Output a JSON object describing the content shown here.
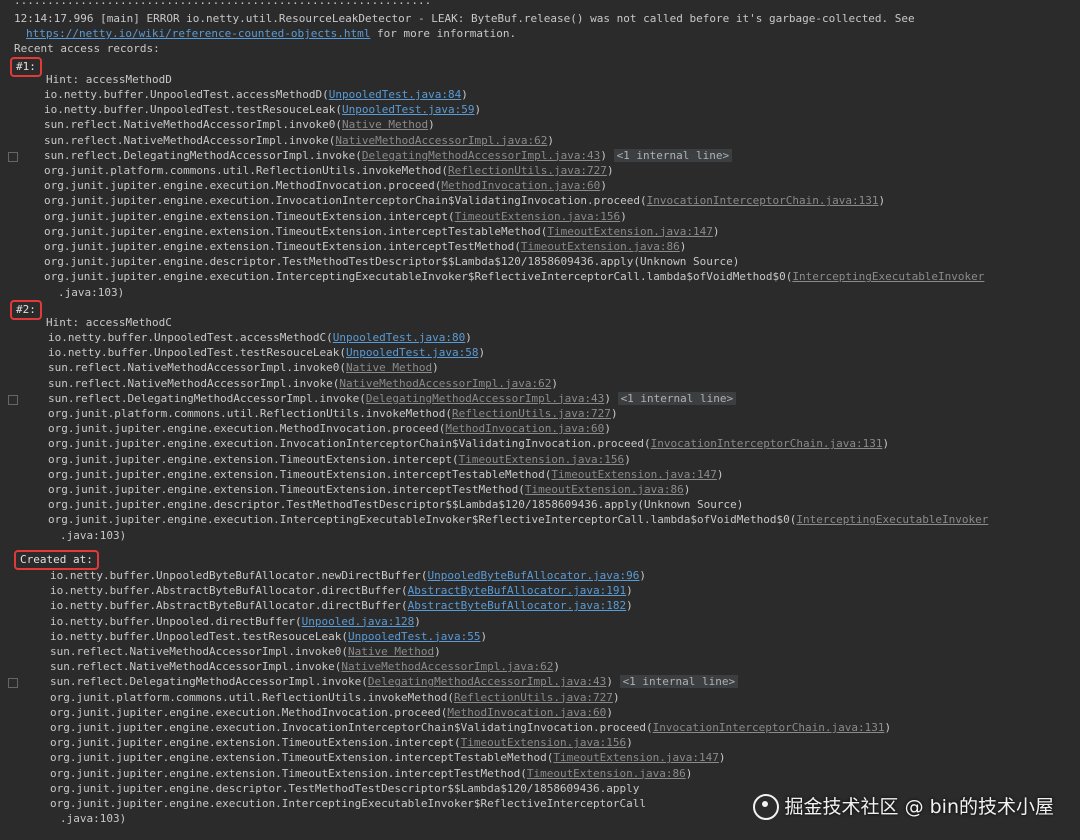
{
  "header": {
    "top_fragment": "...............................................................",
    "leak_line": "12:14:17.996 [main] ERROR io.netty.util.ResourceLeakDetector - LEAK: ByteBuf.release() was not called before it's garbage-collected. See",
    "wiki_link": "https://netty.io/wiki/reference-counted-objects.html",
    "wiki_suffix": " for more information.",
    "recent_access": "Recent access records:"
  },
  "records": [
    {
      "marker": "#1:",
      "hint": "Hint: accessMethodD",
      "frames": [
        {
          "text": "io.netty.buffer.UnpooledTest.accessMethodD(",
          "link": "UnpooledTest.java:84",
          "suffix": ")",
          "style": "link"
        },
        {
          "text": "io.netty.buffer.UnpooledTest.testResouceLeak(",
          "link": "UnpooledTest.java:59",
          "suffix": ")",
          "style": "link"
        },
        {
          "text": "sun.reflect.NativeMethodAccessorImpl.invoke0(",
          "link": "Native Method",
          "suffix": ")",
          "style": "dim"
        },
        {
          "text": "sun.reflect.NativeMethodAccessorImpl.invoke(",
          "link": "NativeMethodAccessorImpl.java:62",
          "suffix": ")",
          "style": "dim"
        },
        {
          "text": "sun.reflect.DelegatingMethodAccessorImpl.invoke(",
          "link": "DelegatingMethodAccessorImpl.java:43",
          "suffix": ")",
          "style": "dim",
          "internal": "<1 internal line>"
        },
        {
          "text": "org.junit.platform.commons.util.ReflectionUtils.invokeMethod(",
          "link": "ReflectionUtils.java:727",
          "suffix": ")",
          "style": "dim"
        },
        {
          "text": "org.junit.jupiter.engine.execution.MethodInvocation.proceed(",
          "link": "MethodInvocation.java:60",
          "suffix": ")",
          "style": "dim"
        },
        {
          "text": "org.junit.jupiter.engine.execution.InvocationInterceptorChain$ValidatingInvocation.proceed(",
          "link": "InvocationInterceptorChain.java:131",
          "suffix": ")",
          "style": "dim"
        },
        {
          "text": "org.junit.jupiter.engine.extension.TimeoutExtension.intercept(",
          "link": "TimeoutExtension.java:156",
          "suffix": ")",
          "style": "dim"
        },
        {
          "text": "org.junit.jupiter.engine.extension.TimeoutExtension.interceptTestableMethod(",
          "link": "TimeoutExtension.java:147",
          "suffix": ")",
          "style": "dim"
        },
        {
          "text": "org.junit.jupiter.engine.extension.TimeoutExtension.interceptTestMethod(",
          "link": "TimeoutExtension.java:86",
          "suffix": ")",
          "style": "dim"
        },
        {
          "text": "org.junit.jupiter.engine.descriptor.TestMethodTestDescriptor$$Lambda$120/1858609436.apply(Unknown Source)",
          "link": "",
          "suffix": "",
          "style": "none"
        },
        {
          "text": "org.junit.jupiter.engine.execution.InterceptingExecutableInvoker$ReflectiveInterceptorCall.lambda$ofVoidMethod$0(",
          "link": "InterceptingExecutableInvoker",
          "suffix": "",
          "style": "dim"
        }
      ],
      "wrap": ".java:103)"
    },
    {
      "marker": "#2:",
      "hint": "Hint: accessMethodC",
      "frames": [
        {
          "text": "io.netty.buffer.UnpooledTest.accessMethodC(",
          "link": "UnpooledTest.java:80",
          "suffix": ")",
          "style": "link"
        },
        {
          "text": "io.netty.buffer.UnpooledTest.testResouceLeak(",
          "link": "UnpooledTest.java:58",
          "suffix": ")",
          "style": "link"
        },
        {
          "text": "sun.reflect.NativeMethodAccessorImpl.invoke0(",
          "link": "Native Method",
          "suffix": ")",
          "style": "dim"
        },
        {
          "text": "sun.reflect.NativeMethodAccessorImpl.invoke(",
          "link": "NativeMethodAccessorImpl.java:62",
          "suffix": ")",
          "style": "dim"
        },
        {
          "text": "sun.reflect.DelegatingMethodAccessorImpl.invoke(",
          "link": "DelegatingMethodAccessorImpl.java:43",
          "suffix": ")",
          "style": "dim",
          "internal": "<1 internal line>"
        },
        {
          "text": "org.junit.platform.commons.util.ReflectionUtils.invokeMethod(",
          "link": "ReflectionUtils.java:727",
          "suffix": ")",
          "style": "dim"
        },
        {
          "text": "org.junit.jupiter.engine.execution.MethodInvocation.proceed(",
          "link": "MethodInvocation.java:60",
          "suffix": ")",
          "style": "dim"
        },
        {
          "text": "org.junit.jupiter.engine.execution.InvocationInterceptorChain$ValidatingInvocation.proceed(",
          "link": "InvocationInterceptorChain.java:131",
          "suffix": ")",
          "style": "dim"
        },
        {
          "text": "org.junit.jupiter.engine.extension.TimeoutExtension.intercept(",
          "link": "TimeoutExtension.java:156",
          "suffix": ")",
          "style": "dim"
        },
        {
          "text": "org.junit.jupiter.engine.extension.TimeoutExtension.interceptTestableMethod(",
          "link": "TimeoutExtension.java:147",
          "suffix": ")",
          "style": "dim"
        },
        {
          "text": "org.junit.jupiter.engine.extension.TimeoutExtension.interceptTestMethod(",
          "link": "TimeoutExtension.java:86",
          "suffix": ")",
          "style": "dim"
        },
        {
          "text": "org.junit.jupiter.engine.descriptor.TestMethodTestDescriptor$$Lambda$120/1858609436.apply(Unknown Source)",
          "link": "",
          "suffix": "",
          "style": "none"
        },
        {
          "text": "org.junit.jupiter.engine.execution.InterceptingExecutableInvoker$ReflectiveInterceptorCall.lambda$ofVoidMethod$0(",
          "link": "InterceptingExecutableInvoker",
          "suffix": "",
          "style": "dim"
        }
      ],
      "wrap": ".java:103)"
    }
  ],
  "created": {
    "marker": "Created at:",
    "frames": [
      {
        "text": "io.netty.buffer.UnpooledByteBufAllocator.newDirectBuffer(",
        "link": "UnpooledByteBufAllocator.java:96",
        "suffix": ")",
        "style": "link"
      },
      {
        "text": "io.netty.buffer.AbstractByteBufAllocator.directBuffer(",
        "link": "AbstractByteBufAllocator.java:191",
        "suffix": ")",
        "style": "link"
      },
      {
        "text": "io.netty.buffer.AbstractByteBufAllocator.directBuffer(",
        "link": "AbstractByteBufAllocator.java:182",
        "suffix": ")",
        "style": "link"
      },
      {
        "text": "io.netty.buffer.Unpooled.directBuffer(",
        "link": "Unpooled.java:128",
        "suffix": ")",
        "style": "link"
      },
      {
        "text": "io.netty.buffer.UnpooledTest.testResouceLeak(",
        "link": "UnpooledTest.java:55",
        "suffix": ")",
        "style": "link"
      },
      {
        "text": "sun.reflect.NativeMethodAccessorImpl.invoke0(",
        "link": "Native Method",
        "suffix": ")",
        "style": "dim"
      },
      {
        "text": "sun.reflect.NativeMethodAccessorImpl.invoke(",
        "link": "NativeMethodAccessorImpl.java:62",
        "suffix": ")",
        "style": "dim"
      },
      {
        "text": "sun.reflect.DelegatingMethodAccessorImpl.invoke(",
        "link": "DelegatingMethodAccessorImpl.java:43",
        "suffix": ")",
        "style": "dim",
        "internal": "<1 internal line>"
      },
      {
        "text": "org.junit.platform.commons.util.ReflectionUtils.invokeMethod(",
        "link": "ReflectionUtils.java:727",
        "suffix": ")",
        "style": "dim"
      },
      {
        "text": "org.junit.jupiter.engine.execution.MethodInvocation.proceed(",
        "link": "MethodInvocation.java:60",
        "suffix": ")",
        "style": "dim"
      },
      {
        "text": "org.junit.jupiter.engine.execution.InvocationInterceptorChain$ValidatingInvocation.proceed(",
        "link": "InvocationInterceptorChain.java:131",
        "suffix": ")",
        "style": "dim"
      },
      {
        "text": "org.junit.jupiter.engine.extension.TimeoutExtension.intercept(",
        "link": "TimeoutExtension.java:156",
        "suffix": ")",
        "style": "dim"
      },
      {
        "text": "org.junit.jupiter.engine.extension.TimeoutExtension.interceptTestableMethod(",
        "link": "TimeoutExtension.java:147",
        "suffix": ")",
        "style": "dim"
      },
      {
        "text": "org.junit.jupiter.engine.extension.TimeoutExtension.interceptTestMethod(",
        "link": "TimeoutExtension.java:86",
        "suffix": ")",
        "style": "dim"
      },
      {
        "text": "org.junit.jupiter.engine.descriptor.TestMethodTestDescriptor$$Lambda$120/1858609436.apply",
        "link": "",
        "suffix": "",
        "style": "none"
      },
      {
        "text": "org.junit.jupiter.engine.execution.InterceptingExecutableInvoker$ReflectiveInterceptorCall",
        "link": "",
        "suffix": "",
        "style": "none"
      }
    ],
    "wrap": ".java:103)"
  },
  "watermark": "掘金技术社区 @ bin的技术小屋"
}
